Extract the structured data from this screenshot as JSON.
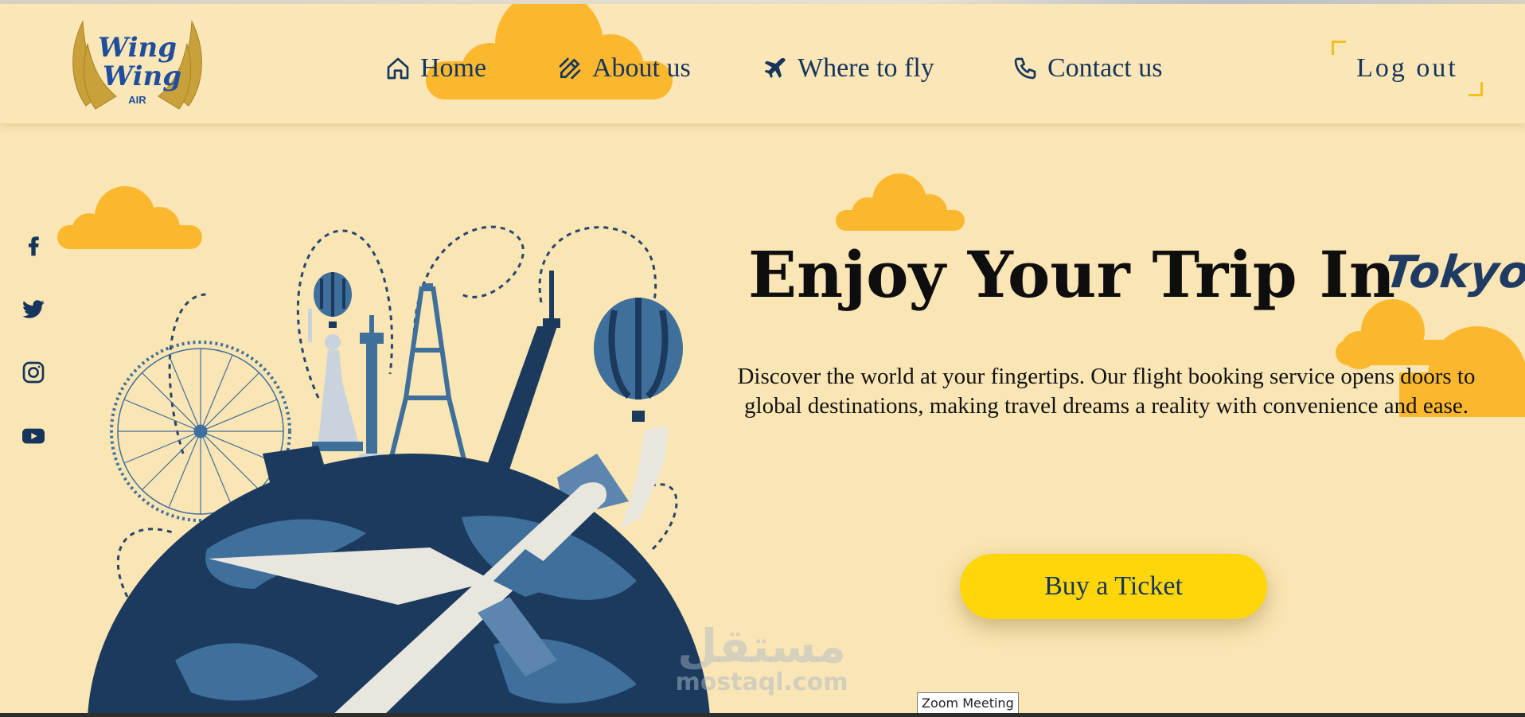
{
  "brand": {
    "name_line1": "Wing",
    "name_line2": "Wing",
    "name_sub": "AIR",
    "accent_color": "#f3c01b",
    "text_color": "#16355c",
    "background_color": "#fae5b4"
  },
  "nav": {
    "items": [
      {
        "label": "Home",
        "icon": "home-icon"
      },
      {
        "label": "About us",
        "icon": "pencil-icon"
      },
      {
        "label": "Where to fly",
        "icon": "plane-icon"
      },
      {
        "label": "Contact us",
        "icon": "phone-icon"
      }
    ],
    "logout_label": "Log out"
  },
  "social": [
    {
      "icon": "facebook-icon"
    },
    {
      "icon": "twitter-icon"
    },
    {
      "icon": "instagram-icon"
    },
    {
      "icon": "youtube-icon"
    }
  ],
  "hero": {
    "title": "Enjoy Your Trip In",
    "city": "Tokyo",
    "description": "Discover the world at your fingertips. Our flight booking service opens doors to global destinations, making travel dreams a reality with convenience and ease.",
    "cta_label": "Buy a Ticket",
    "cta_color": "#fed60a"
  },
  "watermark": {
    "arabic": "مستقل",
    "latin": "mostaql.com"
  },
  "tooltip": "Zoom Meeting"
}
